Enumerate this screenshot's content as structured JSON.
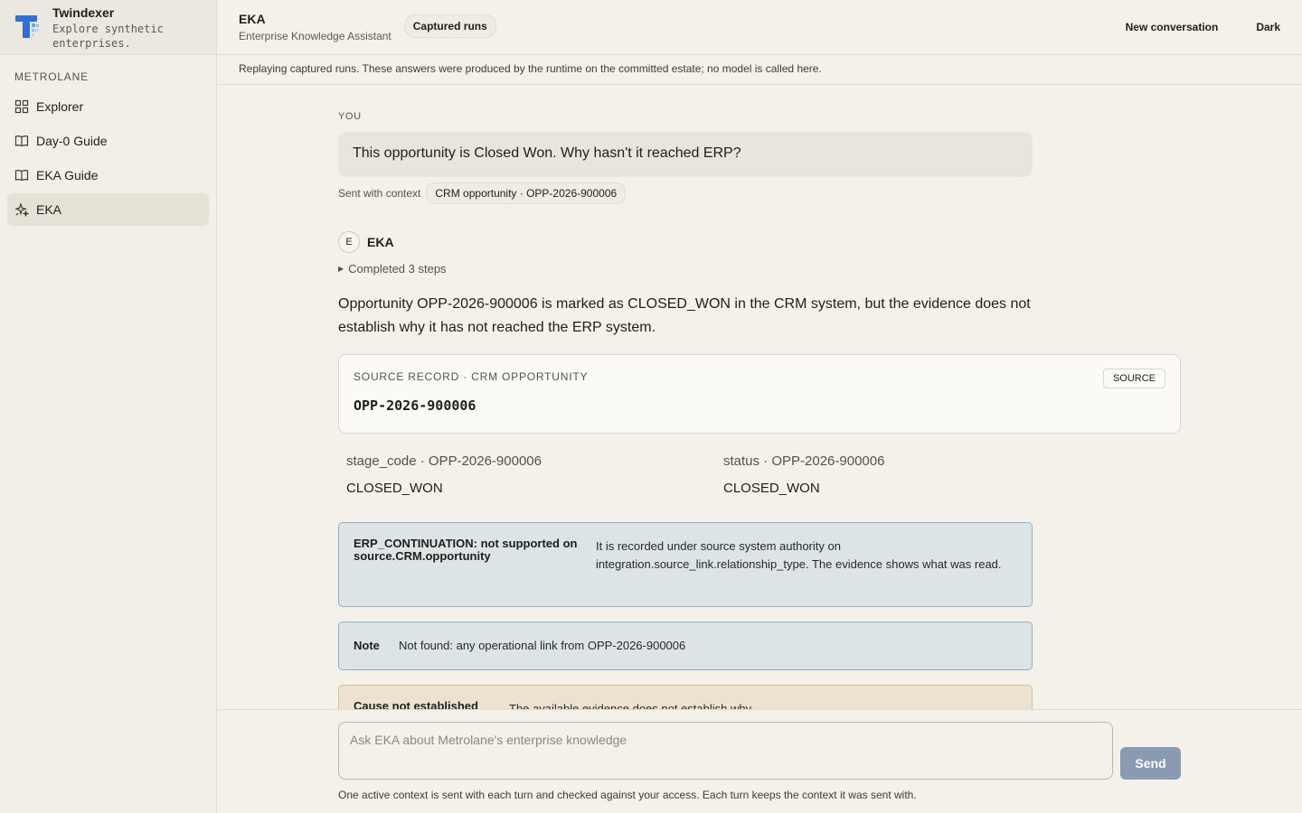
{
  "brand": {
    "name": "Twindexer",
    "tagline": "Explore synthetic enterprises."
  },
  "sidebar": {
    "section": "METROLANE",
    "items": [
      {
        "label": "Explorer",
        "icon": "grid-icon",
        "active": false
      },
      {
        "label": "Day-0 Guide",
        "icon": "book-icon",
        "active": false
      },
      {
        "label": "EKA Guide",
        "icon": "book-icon",
        "active": false
      },
      {
        "label": "EKA",
        "icon": "sparkle-icon",
        "active": true
      }
    ]
  },
  "header": {
    "title": "EKA",
    "subtitle": "Enterprise Knowledge Assistant",
    "pill": "Captured runs",
    "new_conversation": "New conversation",
    "theme": "Dark"
  },
  "banner": "Replaying captured runs. These answers were produced by the runtime on the committed estate; no model is called here.",
  "conversation": {
    "you_label": "YOU",
    "user_message": "This opportunity is Closed Won. Why hasn't it reached ERP?",
    "context_prefix": "Sent with context",
    "context_chip": "CRM opportunity · OPP-2026-900006",
    "assistant_initial": "E",
    "assistant_name": "EKA",
    "steps": "Completed 3 steps",
    "answer": "Opportunity OPP-2026-900006 is marked as CLOSED_WON in the CRM system, but the evidence does not establish why it has not reached the ERP system.",
    "source_card": {
      "label": "SOURCE RECORD · CRM OPPORTUNITY",
      "record_id": "OPP-2026-900006",
      "button": "SOURCE"
    },
    "fields": [
      {
        "key": "stage_code · OPP-2026-900006",
        "value": "CLOSED_WON"
      },
      {
        "key": "status · OPP-2026-900006",
        "value": "CLOSED_WON"
      }
    ],
    "callouts": [
      {
        "title": "ERP_CONTINUATION: not supported on source.CRM.opportunity",
        "body": "It is recorded under source system authority on integration.source_link.relationship_type. The evidence shows what was read."
      },
      {
        "title": "Note",
        "body": "Not found: any operational link from OPP-2026-900006"
      },
      {
        "title": "Cause not established",
        "body": "The available evidence does not establish why"
      }
    ]
  },
  "composer": {
    "placeholder": "Ask EKA about Metrolane's enterprise knowledge",
    "send": "Send",
    "footnote": "One active context is sent with each turn and checked against your access. Each turn keeps the context it was sent with."
  },
  "colors": {
    "accent": "#2f6fd6",
    "send_button": "#8a9ab0",
    "info_callout": "#dce4e6",
    "warn_callout": "#ece2cf"
  }
}
